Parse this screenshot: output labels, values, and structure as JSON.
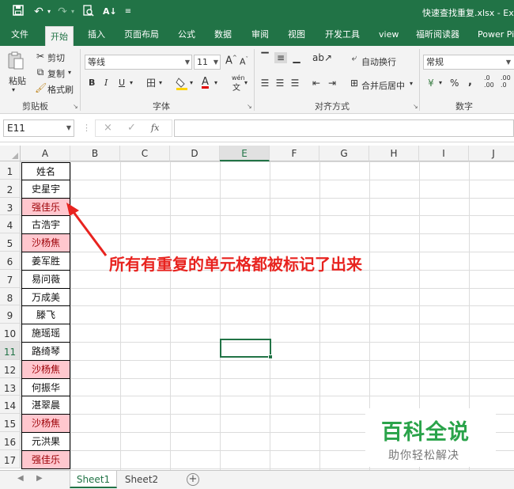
{
  "titlebar": {
    "doc_title": "快速查找重复.xlsx  -  Ex",
    "quick_access": [
      "save-icon",
      "undo-icon",
      "redo-icon",
      "print-preview-icon",
      "sort-icon",
      "customize-icon"
    ]
  },
  "ribbon_tabs": [
    "文件",
    "开始",
    "插入",
    "页面布局",
    "公式",
    "数据",
    "审阅",
    "视图",
    "开发工具",
    "view",
    "福昕阅读器",
    "Power Pi"
  ],
  "active_tab": "开始",
  "clipboard": {
    "paste": "粘贴",
    "cut": "剪切",
    "copy": "复制",
    "format_painter": "格式刷",
    "group": "剪贴板"
  },
  "font": {
    "name": "等线",
    "size": "11",
    "bold": "B",
    "italic": "I",
    "underline": "U",
    "grow": "A",
    "shrink": "A",
    "group": "字体",
    "font_color": "A",
    "wen": "wén",
    "phonetic": "文"
  },
  "alignment": {
    "wrap": "自动换行",
    "merge": "合并后居中",
    "group": "对齐方式"
  },
  "number": {
    "format": "常规",
    "percent": "%",
    "comma": ",",
    "inc_dec_a": ".0",
    ".00": ".00",
    "group": "数字",
    "dec_a": ".00",
    "dec_b": ".0"
  },
  "formula_bar": {
    "name_box": "E11",
    "fx": "fx",
    "cancel": "×",
    "enter": "✓"
  },
  "columns": [
    "A",
    "B",
    "C",
    "D",
    "E",
    "F",
    "G",
    "H",
    "I",
    "J"
  ],
  "selected_column": "E",
  "rows": [
    "1",
    "2",
    "3",
    "4",
    "5",
    "6",
    "7",
    "8",
    "9",
    "10",
    "11",
    "12",
    "13",
    "14",
    "15",
    "16",
    "17"
  ],
  "selected_row": "11",
  "column_a": [
    "姓名",
    "史星宇",
    "强佳乐",
    "古浩宇",
    "沙杨焦",
    "姜军胜",
    "易问薇",
    "万成美",
    "滕飞",
    "施瑶瑶",
    "路绮琴",
    "沙杨焦",
    "何振华",
    "湛翠晨",
    "沙杨焦",
    "元洪果",
    "强佳乐"
  ],
  "duplicate_rows": [
    3,
    5,
    12,
    15,
    17
  ],
  "duplicate_fill_color": "#ffc7ce",
  "duplicate_text_color": "#9c0006",
  "annotation": "所有有重复的单元格都被标记了出来",
  "annotation_color": "#e8231f",
  "watermark": {
    "title": "百科全说",
    "subtitle": "助你轻松解决"
  },
  "sheets": [
    "Sheet1",
    "Sheet2"
  ],
  "active_sheet": "Sheet1",
  "accent_color": "#217346"
}
